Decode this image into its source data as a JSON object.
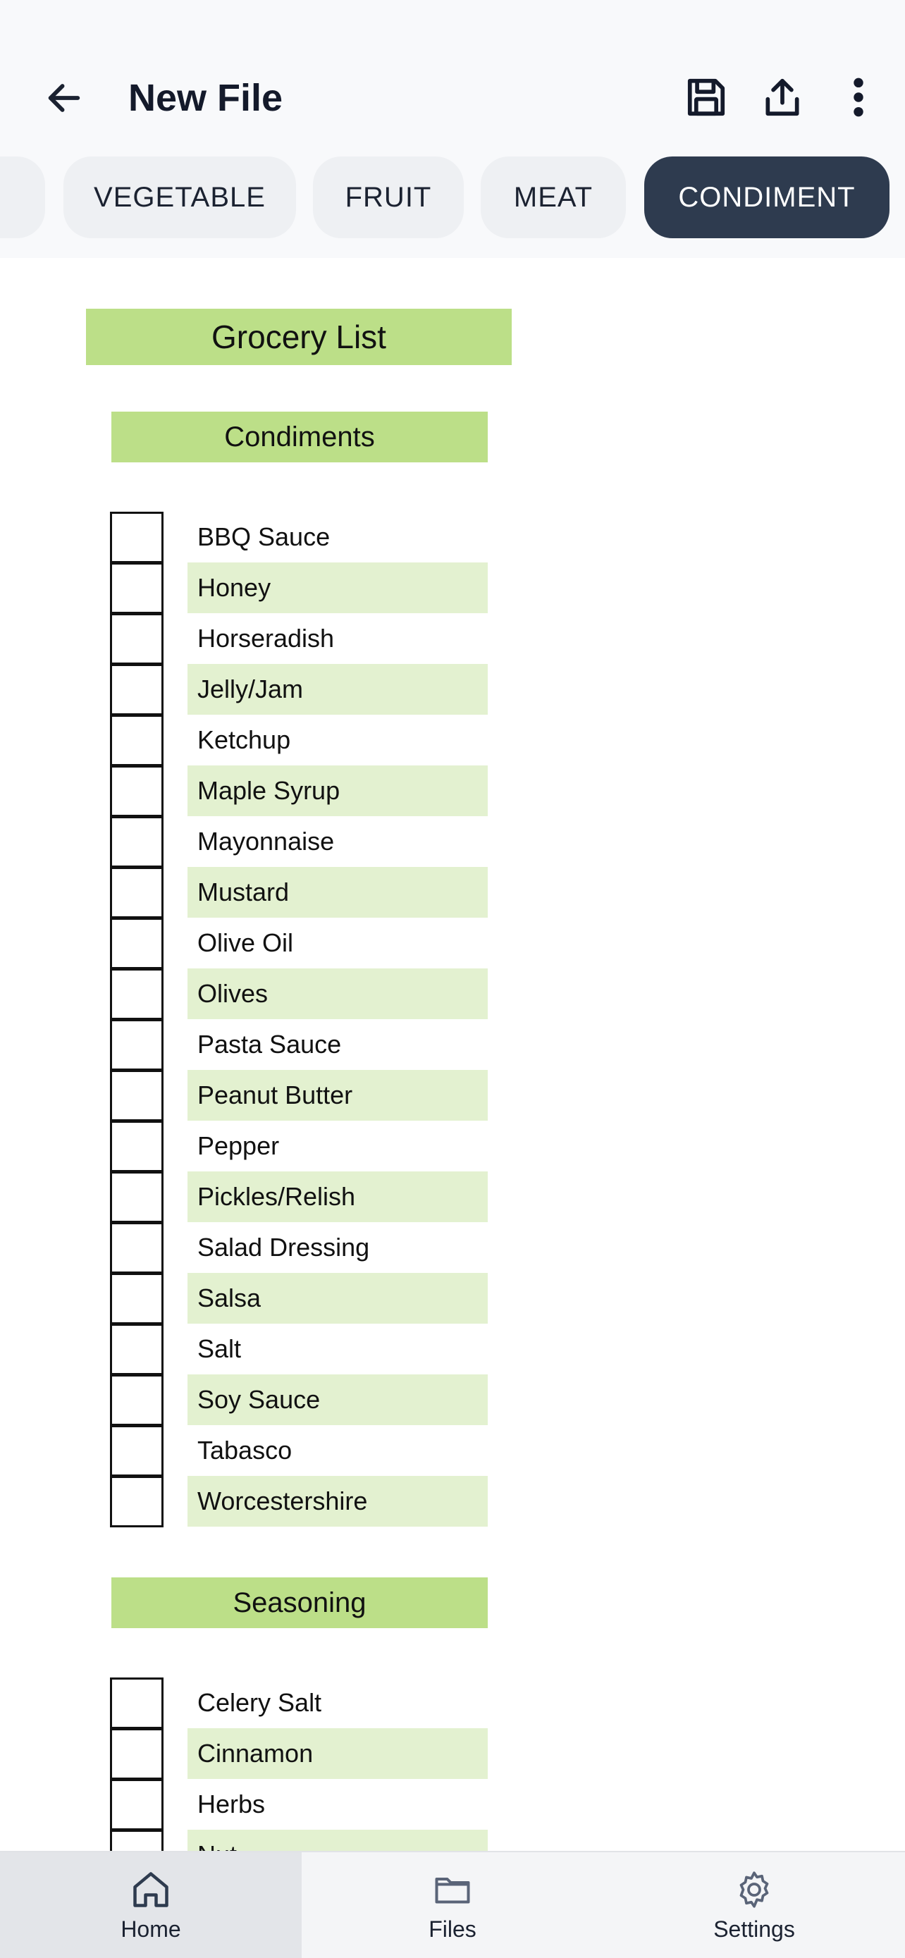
{
  "header": {
    "title": "New File",
    "back_icon": "arrow-left-icon",
    "actions": [
      "save-icon",
      "share-icon",
      "more-vertical-icon"
    ]
  },
  "tabs": [
    {
      "label": "",
      "active": false
    },
    {
      "label": "VEGETABLE",
      "active": false
    },
    {
      "label": "FRUIT",
      "active": false
    },
    {
      "label": "MEAT",
      "active": false
    },
    {
      "label": "CONDIMENT",
      "active": true
    }
  ],
  "sheet": {
    "title": "Grocery List",
    "sections": [
      {
        "name": "Condiments",
        "items": [
          "BBQ Sauce",
          "Honey",
          "Horseradish",
          "Jelly/Jam",
          "Ketchup",
          "Maple Syrup",
          "Mayonnaise",
          "Mustard",
          "Olive Oil",
          "Olives",
          "Pasta Sauce",
          "Peanut Butter",
          "Pepper",
          "Pickles/Relish",
          "Salad Dressing",
          "Salsa",
          "Salt",
          "Soy Sauce",
          "Tabasco",
          "Worcestershire"
        ]
      },
      {
        "name": "Seasoning",
        "items": [
          "Celery Salt",
          "Cinnamon",
          "Herbs",
          "Nut"
        ]
      }
    ]
  },
  "bottom_nav": [
    {
      "label": "Home",
      "icon": "home-icon",
      "active": true
    },
    {
      "label": "Files",
      "icon": "folder-icon",
      "active": false
    },
    {
      "label": "Settings",
      "icon": "gear-icon",
      "active": false
    }
  ],
  "colors": {
    "header_bg": "#f8f9fb",
    "tab_active_bg": "#2e3b4f",
    "section_green": "#bcdf88",
    "row_alt_green": "#e3f1d0"
  }
}
